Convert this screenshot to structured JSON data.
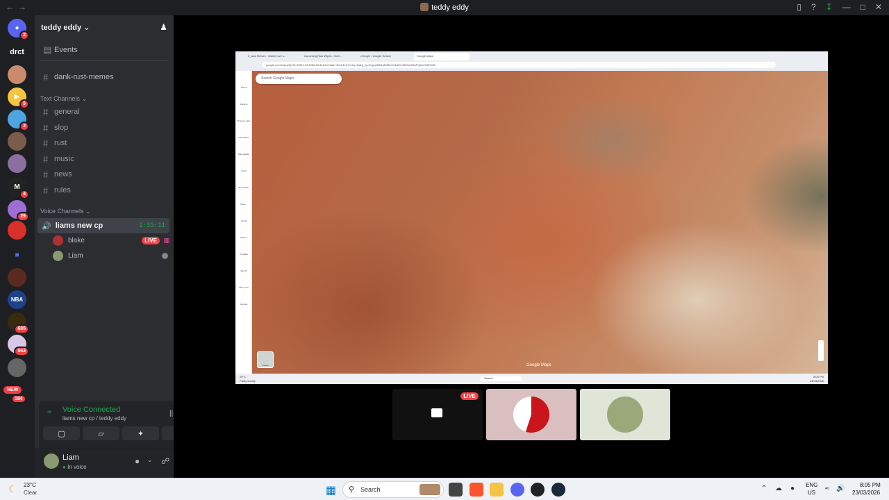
{
  "window": {
    "title": "teddy eddy"
  },
  "server": {
    "name": "teddy eddy",
    "abbrev": "drct"
  },
  "guild_badges": {
    "discord": "2",
    "g3": "5",
    "g4": "3",
    "g8": "4",
    "g10": "29",
    "nba": "685",
    "g14": "563",
    "new_label": "NEW",
    "new_count": "184"
  },
  "channels": {
    "events": "Events",
    "top": "dank-rust-memes",
    "text_category": "Text Channels",
    "text": [
      "general",
      "slop",
      "rust",
      "music",
      "news",
      "rules"
    ],
    "voice_category": "Voice Channels",
    "voice_channel": "liams new cp",
    "voice_timer": "1:35:11",
    "voice_users": [
      "blake",
      "Liam"
    ],
    "live_label": "LIVE"
  },
  "voice_panel": {
    "title": "Voice Connected",
    "subtitle": "liams new cp / teddy eddy"
  },
  "user": {
    "name": "Liam",
    "status": "In voice"
  },
  "stream": {
    "tabs": [
      "It_was Stream - Watch Live o...",
      "Upcoming Rust Wipes - Next...",
      "r/Cloght - Google Search",
      "Google Maps"
    ],
    "url": "google.com/maps/@-25.9405,133.1588,85.8414m/data=!3m1!1e3?entry=ttu&g_ep=EgoyMDI1MDMxOC4wIKXMDSoASAFQAw%3D%3D",
    "search_placeholder": "Search Google Maps",
    "sidebar": [
      "Saved",
      "Recents",
      "Simpson Lake",
      "Park Street",
      "Marmaduke Road",
      "Eric Street",
      "Uluru...",
      "Yanda",
      "Kings 2",
      "Kinsdale",
      "Day St",
      "View more",
      "Get app"
    ],
    "layers_label": "Layers",
    "map_logo": "Google Maps",
    "taskbar_weather": "29°C",
    "taskbar_weather_sub": "Partly cloudy",
    "taskbar_search": "Search",
    "taskbar_time": "8:05 PM",
    "taskbar_date": "23/03/2026"
  },
  "thumbs": {
    "live_label": "LIVE"
  },
  "taskbar": {
    "temp": "23°C",
    "weather": "Clear",
    "search": "Search",
    "lang1": "ENG",
    "lang2": "US",
    "time": "8:05 PM",
    "date": "23/03/2026"
  }
}
